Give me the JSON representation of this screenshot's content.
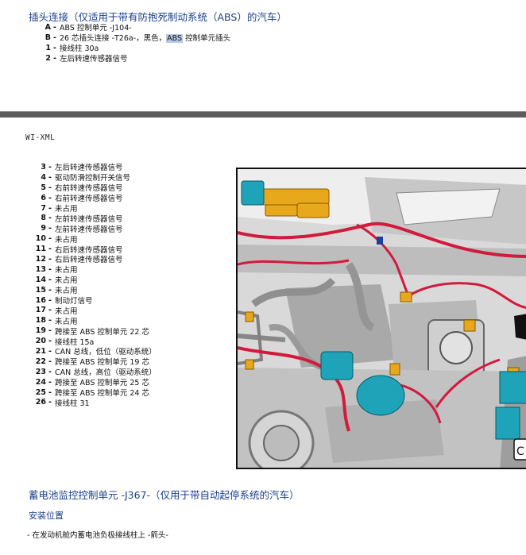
{
  "connector_section": {
    "title": "插头连接（仅适用于带有防抱死制动系统（ABS）的汽车）",
    "items": [
      {
        "id": "A",
        "text": "ABS 控制单元 -J104-"
      },
      {
        "id": "B",
        "text_pre": "26 芯插头连接 -T26a-，黑色，",
        "highlight": "ABS",
        "text_post": " 控制单元插头"
      },
      {
        "id": "1",
        "text": "接线柱 30a"
      },
      {
        "id": "2",
        "text": "左后转速传感器信号"
      }
    ]
  },
  "wi_tag": "WI-XML",
  "pins": [
    {
      "id": "3",
      "text": "左后转速传感器信号"
    },
    {
      "id": "4",
      "text": "驱动防滑控制开关信号"
    },
    {
      "id": "5",
      "text": "右前转速传感器信号"
    },
    {
      "id": "6",
      "text": "右前转速传感器信号"
    },
    {
      "id": "7",
      "text": "未占用"
    },
    {
      "id": "8",
      "text": "左前转速传感器信号"
    },
    {
      "id": "9",
      "text": "左前转速传感器信号"
    },
    {
      "id": "10",
      "text": "未占用"
    },
    {
      "id": "11",
      "text": "右后转速传感器信号"
    },
    {
      "id": "12",
      "text": "右后转速传感器信号"
    },
    {
      "id": "13",
      "text": "未占用"
    },
    {
      "id": "14",
      "text": "未占用"
    },
    {
      "id": "15",
      "text": "未占用"
    },
    {
      "id": "16",
      "text": "制动灯信号"
    },
    {
      "id": "17",
      "text": "未占用"
    },
    {
      "id": "18",
      "text": "未占用"
    },
    {
      "id": "19",
      "text": "跨接至 ABS 控制单元 22 芯"
    },
    {
      "id": "20",
      "text": "接线柱 15a"
    },
    {
      "id": "21",
      "text": "CAN 总线，低位（驱动系统）"
    },
    {
      "id": "22",
      "text": "跨接至 ABS 控制单元 19 芯"
    },
    {
      "id": "23",
      "text": "CAN 总线，高位（驱动系统）"
    },
    {
      "id": "24",
      "text": "跨接至 ABS 控制单元 25 芯"
    },
    {
      "id": "25",
      "text": "跨接至 ABS 控制单元 24 芯"
    },
    {
      "id": "26",
      "text": "接线柱 31"
    }
  ],
  "photo": {
    "corner_label": "C"
  },
  "battery_section": {
    "title": "蓄电池监控控制单元 -J367-（仅用于带自动起停系统的汽车）",
    "subtitle": "安装位置",
    "bullet": "- 在发动机舱内蓄电池负极接线柱上 -箭头-"
  },
  "colors": {
    "heading": "#1a3f8a",
    "separator": "#5d5d5d",
    "highlight": "#b7c9e6",
    "harness_red": "#d21a3c",
    "connector_yellow": "#e8a81c",
    "component_cyan": "#1fa3b8"
  }
}
